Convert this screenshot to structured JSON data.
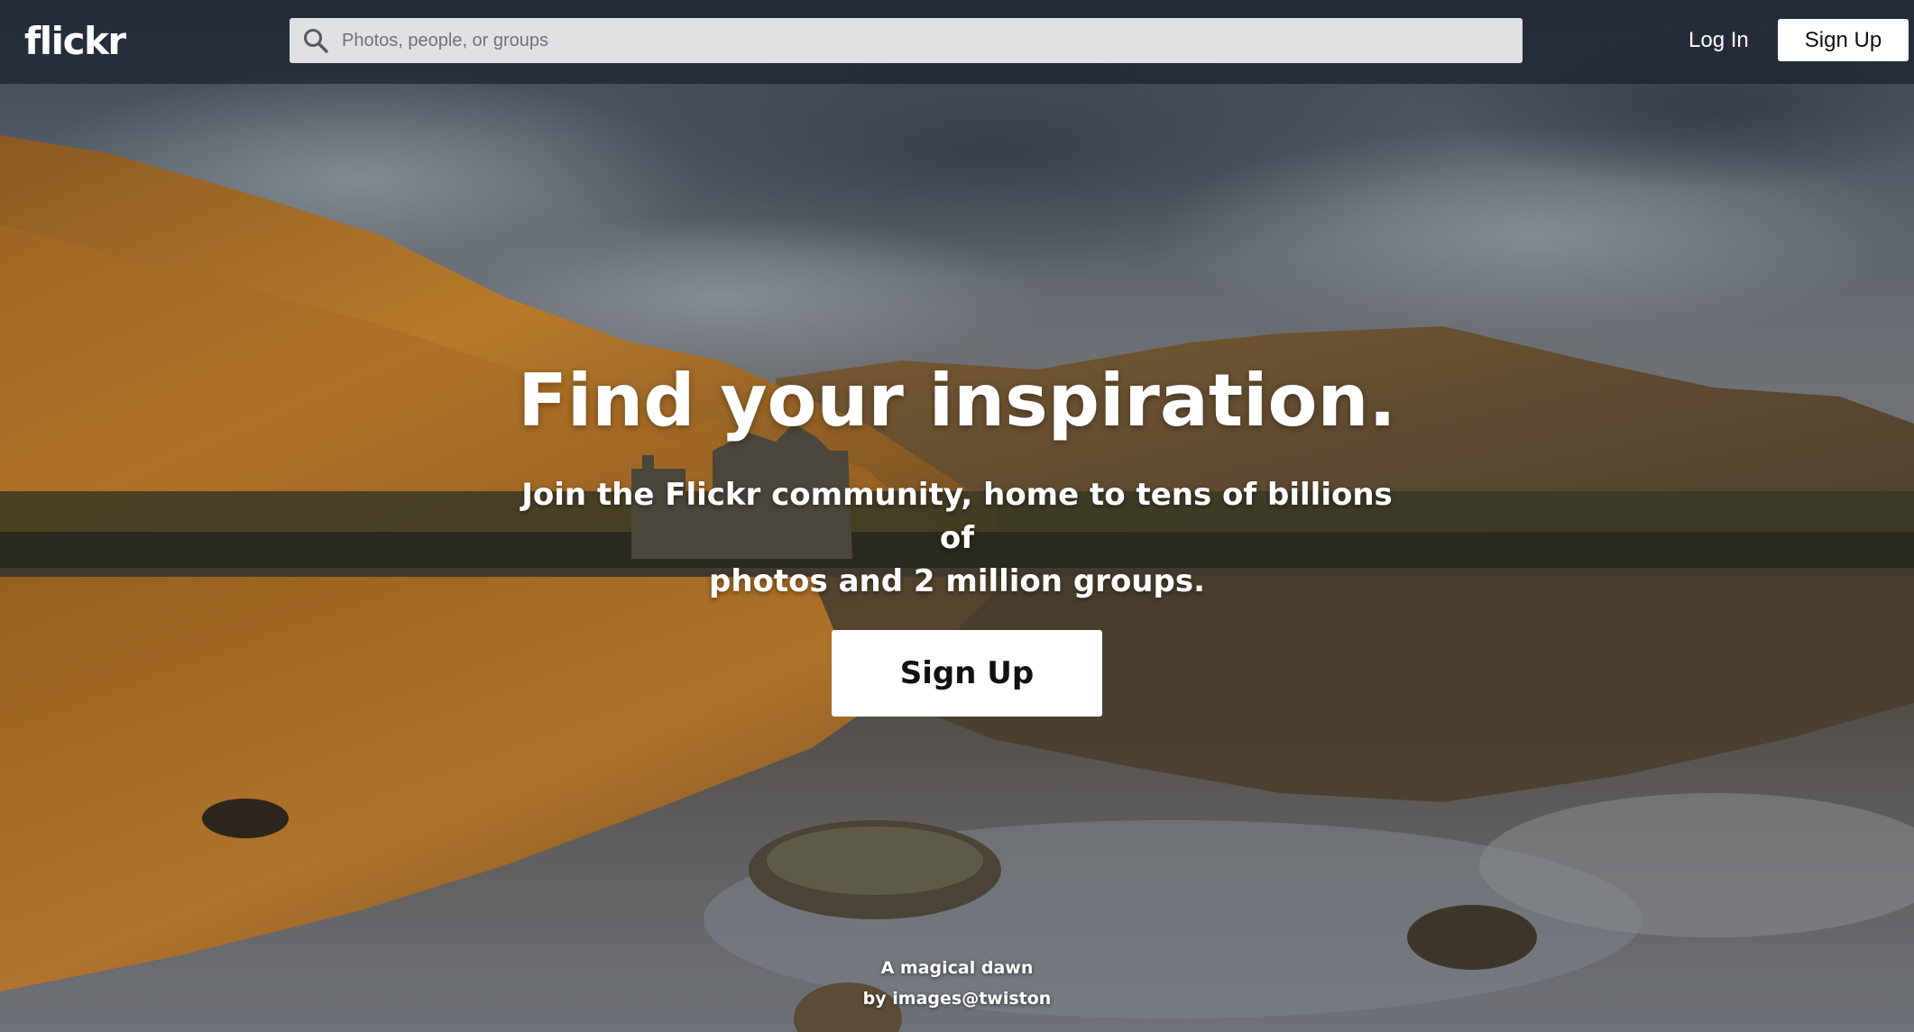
{
  "brand": {
    "logo_text": "flickr"
  },
  "header": {
    "search_placeholder": "Photos, people, or groups",
    "search_value": "",
    "login_label": "Log In",
    "signup_label": "Sign Up"
  },
  "hero": {
    "title": "Find your inspiration.",
    "subtitle_line1": "Join the Flickr community, home to tens of billions of",
    "subtitle_line2": "photos and 2 million groups.",
    "signup_label": "Sign Up"
  },
  "photo_credit": {
    "title": "A magical dawn",
    "author_line": "by images@twiston"
  },
  "colors": {
    "header_bg": "#141c28",
    "button_bg": "#ffffff",
    "text_light": "#ffffff"
  },
  "icons": {
    "search": "search-icon"
  }
}
